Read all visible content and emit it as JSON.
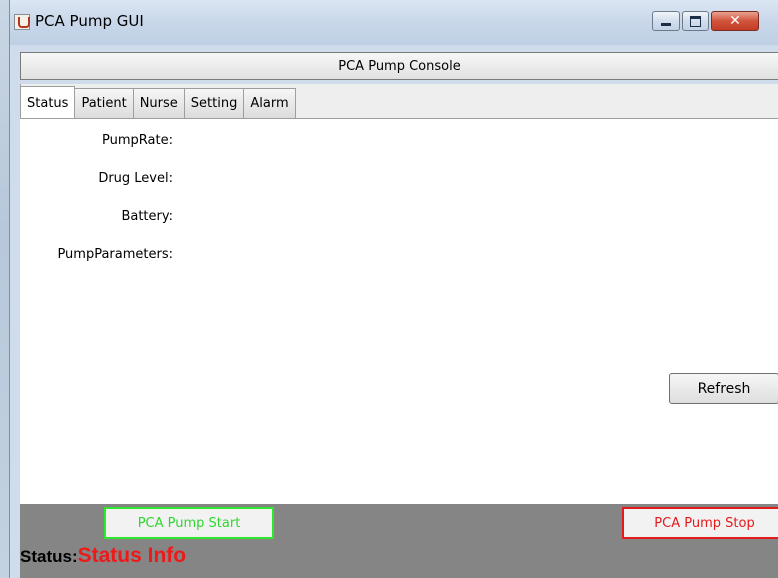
{
  "window": {
    "title": "PCA Pump GUI"
  },
  "header": {
    "console_label": "PCA Pump Console"
  },
  "tabs": [
    {
      "label": "Status",
      "active": true
    },
    {
      "label": "Patient",
      "active": false
    },
    {
      "label": "Nurse",
      "active": false
    },
    {
      "label": "Setting",
      "active": false
    },
    {
      "label": "Alarm",
      "active": false
    }
  ],
  "status_panel": {
    "fields": [
      {
        "label": "PumpRate:"
      },
      {
        "label": "Drug Level:"
      },
      {
        "label": "Battery:"
      },
      {
        "label": "PumpParameters:"
      }
    ],
    "refresh_label": "Refresh"
  },
  "footer": {
    "start_label": "PCA Pump Start",
    "stop_label": "PCA Pump Stop",
    "status_key": "Status:",
    "status_value": "Status Info"
  },
  "colors": {
    "start_accent": "#2ee82e",
    "stop_accent": "#e51a1a",
    "status_value": "#ee1a1a",
    "bottom_bar": "#858585"
  },
  "icons": {
    "app": "java-cup-icon",
    "minimize": "minimize-icon",
    "maximize": "maximize-icon",
    "close": "close-icon"
  }
}
